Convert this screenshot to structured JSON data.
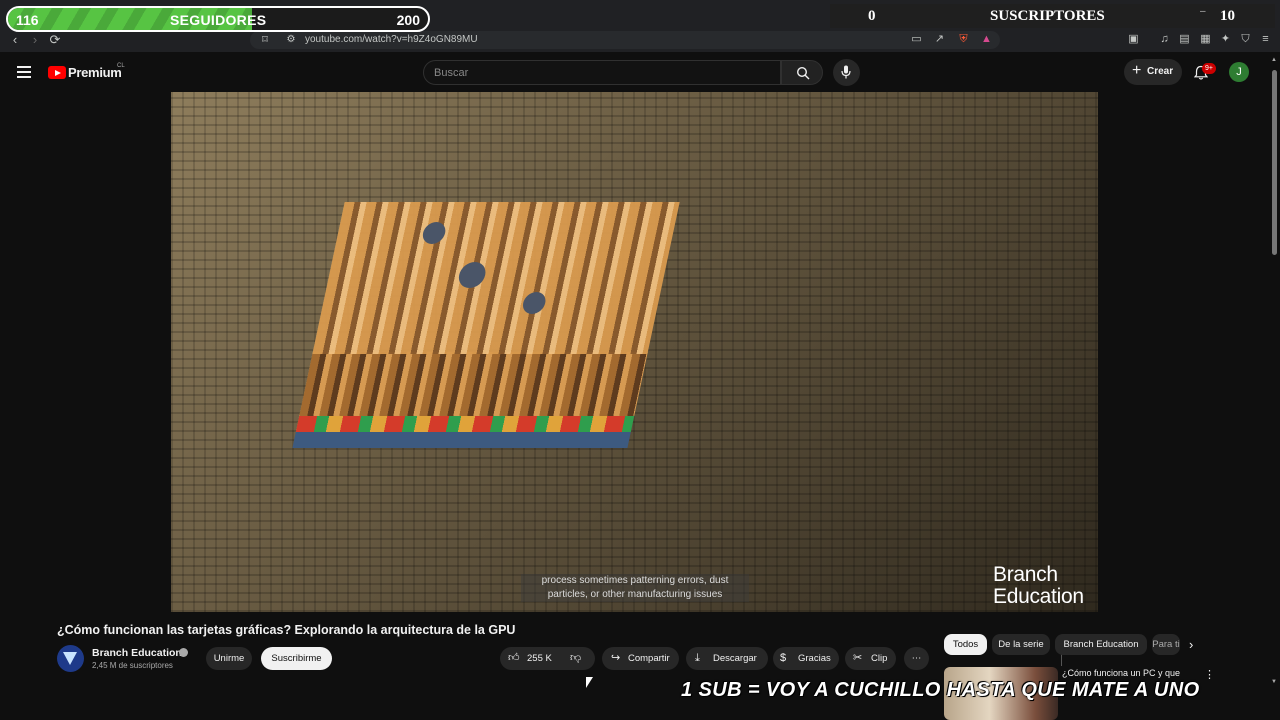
{
  "overlay_counters": {
    "followers": {
      "current": "116",
      "label": "SEGUIDORES",
      "goal": "200",
      "progress": 0.58
    },
    "subscribers": {
      "current": "0",
      "label": "SUSCRIPTORES",
      "goal": "10"
    }
  },
  "browser": {
    "url": "youtube.com/watch?v=h9Z4oGN89MU"
  },
  "header": {
    "logo_text": "Premium",
    "region": "CL",
    "search_placeholder": "Buscar",
    "create_label": "Crear",
    "notifications_badge": "9+",
    "avatar_letter": "J"
  },
  "video": {
    "caption": "process sometimes patterning errors, dust particles, or other manufacturing issues",
    "watermark": [
      "Branch",
      "Education"
    ]
  },
  "watch": {
    "title": "¿Cómo funcionan las tarjetas gráficas? Explorando la arquitectura de la GPU",
    "channel_name": "Branch Education",
    "subscribers": "2,45 M de suscriptores",
    "join_label": "Unirme",
    "subscribe_label": "Suscribirme",
    "likes": "255 K",
    "share_label": "Compartir",
    "download_label": "Descargar",
    "thanks_label": "Gracias",
    "clip_label": "Clip"
  },
  "filters": {
    "chips": [
      "Todos",
      "De la serie",
      "Branch Education",
      "Para ti"
    ]
  },
  "recommendation": {
    "title": "¿Cómo funciona un PC y que"
  },
  "stream_overlay": {
    "text": "1 SUB =  VOY A CUCHILLO HASTA QUE MATE A UNO"
  },
  "colors": {
    "progress_green": "#57c443",
    "youtube_red": "#ff0000",
    "background": "#0f0f0f"
  }
}
